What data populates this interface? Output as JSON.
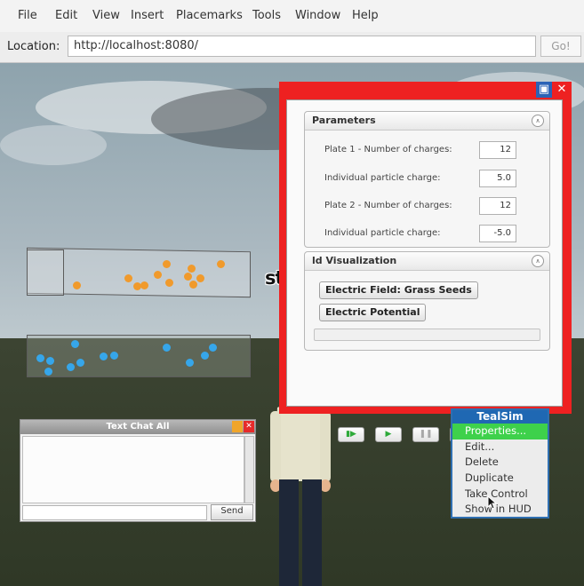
{
  "menu": [
    "File",
    "Edit",
    "View",
    "Insert",
    "Placemarks",
    "Tools",
    "Window",
    "Help"
  ],
  "location": {
    "label": "Location:",
    "url": "http://localhost:8080/",
    "go_label": "Go!"
  },
  "panel": {
    "minimize_icon": "window-icon",
    "close_icon": "close-icon",
    "parameters": {
      "title": "Parameters",
      "rows": [
        {
          "label": "Plate 1 - Number of charges:",
          "value": "12"
        },
        {
          "label": "Individual particle charge:",
          "value": "5.0"
        },
        {
          "label": "Plate 2 - Number of charges:",
          "value": "12"
        },
        {
          "label": "Individual particle charge:",
          "value": "-5.0"
        }
      ]
    },
    "field_visualization": {
      "title": "ld Visualization",
      "buttons": [
        "Electric Field:  Grass Seeds",
        "Electric Potential"
      ]
    },
    "controls": [
      "play-step-icon",
      "play-icon",
      "pause-icon",
      "stop-icon",
      "rewind-icon"
    ],
    "control_colors": {
      "active": "#2eaa3a",
      "stop": "#d62020",
      "disabled": "#a8a8a8"
    }
  },
  "avatar": {
    "name": "stefan"
  },
  "chat": {
    "title": "Text Chat All",
    "send_label": "Send"
  },
  "context_menu": {
    "title": "TealSim",
    "items": [
      "Properties...",
      "Edit...",
      "Delete",
      "Duplicate",
      "Take Control",
      "Show in HUD"
    ],
    "selected_index": 0
  },
  "colors": {
    "panel_border": "#ee2121",
    "menu_header": "#1f68b3",
    "menu_selected": "#3ed14b",
    "positive_charge": "#f09a2c",
    "negative_charge": "#36a6ea"
  }
}
